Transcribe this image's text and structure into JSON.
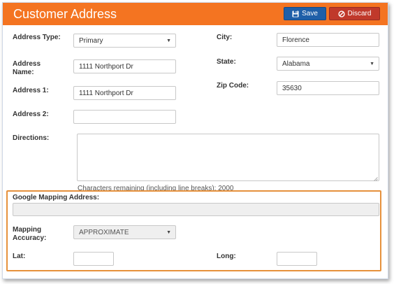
{
  "header": {
    "title": "Customer Address",
    "save_label": "Save",
    "discard_label": "Discard",
    "save_icon": "floppy-disk-icon",
    "discard_icon": "ban-circle-icon",
    "accent_color": "#f47421",
    "save_color": "#1f5fa8",
    "discard_color": "#c0392b"
  },
  "form": {
    "address_type": {
      "label": "Address Type:",
      "value": "Primary"
    },
    "address_name": {
      "label": "Address Name:",
      "value": "1111 Northport Dr"
    },
    "address1": {
      "label": "Address 1:",
      "value": "1111 Northport Dr"
    },
    "address2": {
      "label": "Address 2:",
      "value": ""
    },
    "city": {
      "label": "City:",
      "value": "Florence"
    },
    "state": {
      "label": "State:",
      "value": "Alabama"
    },
    "zip": {
      "label": "Zip Code:",
      "value": "35630"
    },
    "directions": {
      "label": "Directions:",
      "value": "",
      "hint": "Characters remaining (including line breaks): 2000"
    }
  },
  "mapping": {
    "highlight_color": "#e6913c",
    "google_label": "Google Mapping Address:",
    "google_value": "",
    "accuracy_label": "Mapping Accuracy:",
    "accuracy_value": "APPROXIMATE",
    "lat_label": "Lat:",
    "lat_value": "",
    "long_label": "Long:",
    "long_value": ""
  }
}
